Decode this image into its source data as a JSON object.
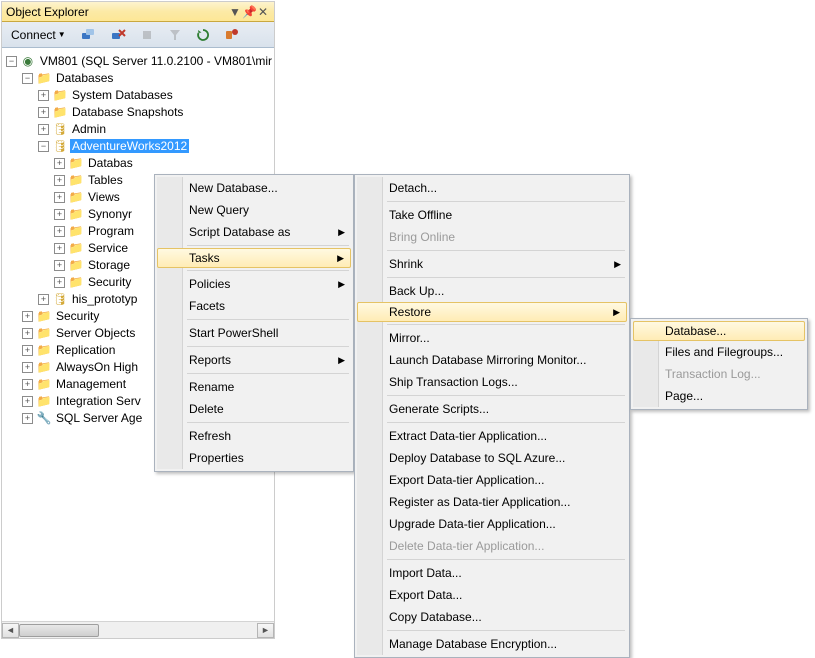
{
  "panel": {
    "title": "Object Explorer"
  },
  "toolbar": {
    "connect": "Connect"
  },
  "tree": {
    "server": "VM801 (SQL Server 11.0.2100 - VM801\\mir",
    "databases": "Databases",
    "items_top": [
      "System Databases",
      "Database Snapshots",
      "Admin"
    ],
    "selected": "AdventureWorks2012",
    "children": [
      "Databas",
      "Tables",
      "Views",
      "Synonyr",
      "Program",
      "Service",
      "Storage",
      "Security"
    ],
    "prototype": "his_prototyp",
    "bottom": [
      "Security",
      "Server Objects",
      "Replication",
      "AlwaysOn High",
      "Management",
      "Integration Serv",
      "SQL Server Age"
    ]
  },
  "menu1": {
    "new_db": "New Database...",
    "new_query": "New Query",
    "script_as": "Script Database as",
    "tasks": "Tasks",
    "policies": "Policies",
    "facets": "Facets",
    "start_ps": "Start PowerShell",
    "reports": "Reports",
    "rename": "Rename",
    "delete": "Delete",
    "refresh": "Refresh",
    "properties": "Properties"
  },
  "menu2": {
    "detach": "Detach...",
    "take_offline": "Take Offline",
    "bring_online": "Bring Online",
    "shrink": "Shrink",
    "backup": "Back Up...",
    "restore": "Restore",
    "mirror": "Mirror...",
    "launch_mirror": "Launch Database Mirroring Monitor...",
    "ship_logs": "Ship Transaction Logs...",
    "gen_scripts": "Generate Scripts...",
    "extract_dt": "Extract Data-tier Application...",
    "deploy_azure": "Deploy Database to SQL Azure...",
    "export_dt": "Export Data-tier Application...",
    "register_dt": "Register as Data-tier Application...",
    "upgrade_dt": "Upgrade Data-tier Application...",
    "delete_dt": "Delete Data-tier Application...",
    "import": "Import Data...",
    "export": "Export Data...",
    "copy_db": "Copy Database...",
    "encryption": "Manage Database Encryption..."
  },
  "menu3": {
    "database": "Database...",
    "files": "Files and Filegroups...",
    "tlog": "Transaction Log...",
    "page": "Page..."
  }
}
